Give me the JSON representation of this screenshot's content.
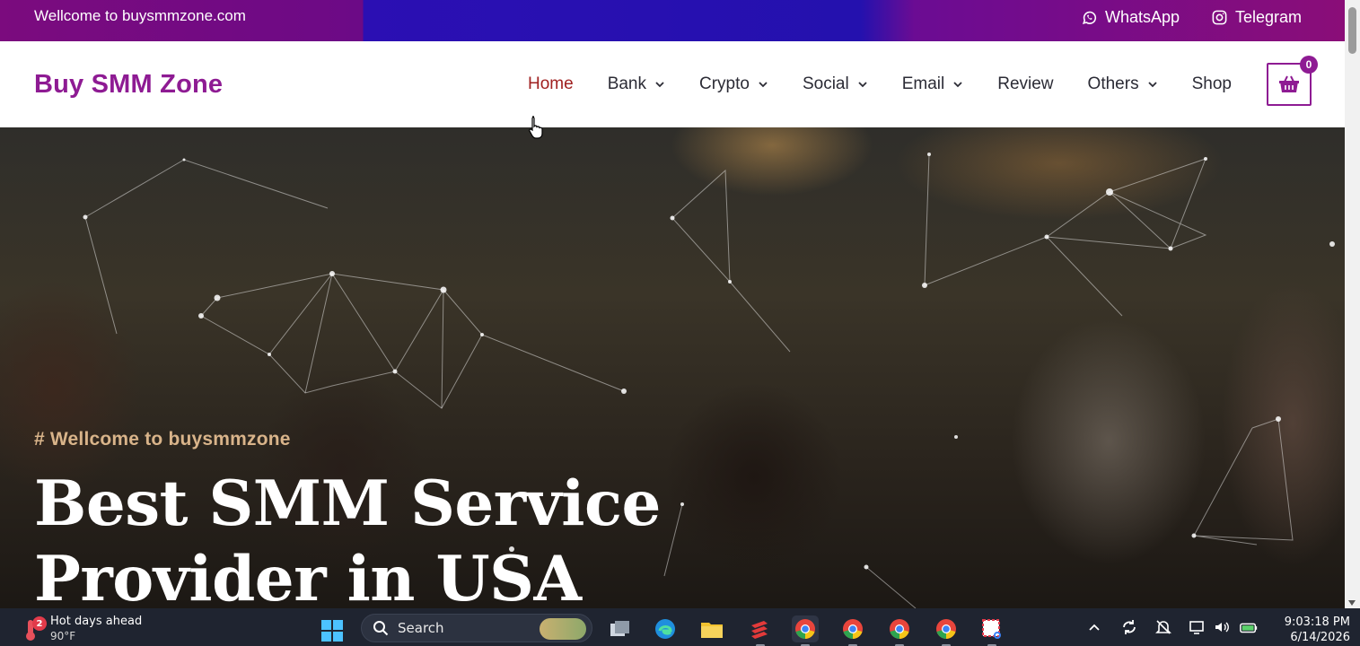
{
  "topbar": {
    "welcome": "Wellcome to buysmmzone.com",
    "whatsapp_label": "WhatsApp",
    "telegram_label": "Telegram"
  },
  "header": {
    "brand": "Buy SMM Zone",
    "nav": [
      {
        "label": "Home",
        "active": true,
        "dropdown": false
      },
      {
        "label": "Bank",
        "active": false,
        "dropdown": true
      },
      {
        "label": "Crypto",
        "active": false,
        "dropdown": true
      },
      {
        "label": "Social",
        "active": false,
        "dropdown": true
      },
      {
        "label": "Email",
        "active": false,
        "dropdown": true
      },
      {
        "label": "Review",
        "active": false,
        "dropdown": false
      },
      {
        "label": "Others",
        "active": false,
        "dropdown": true
      },
      {
        "label": "Shop",
        "active": false,
        "dropdown": false
      }
    ],
    "cart_count": "0",
    "cart_icon": "shopping-bag-icon"
  },
  "hero": {
    "tagline": "# Wellcome to buysmmzone",
    "headline_line1": "Best SMM Service",
    "headline_line2": "Provider in USA"
  },
  "taskbar": {
    "weather_title": "Hot days ahead",
    "weather_temp": "90°F",
    "weather_badge": "2",
    "search_placeholder": "Search",
    "time": "9:03:18 PM",
    "date": "6/14/2026"
  },
  "colors": {
    "brand": "#8e1b93",
    "nav_active": "#a02020",
    "tagline": "#d9b48a",
    "taskbar": "#1f2430"
  }
}
